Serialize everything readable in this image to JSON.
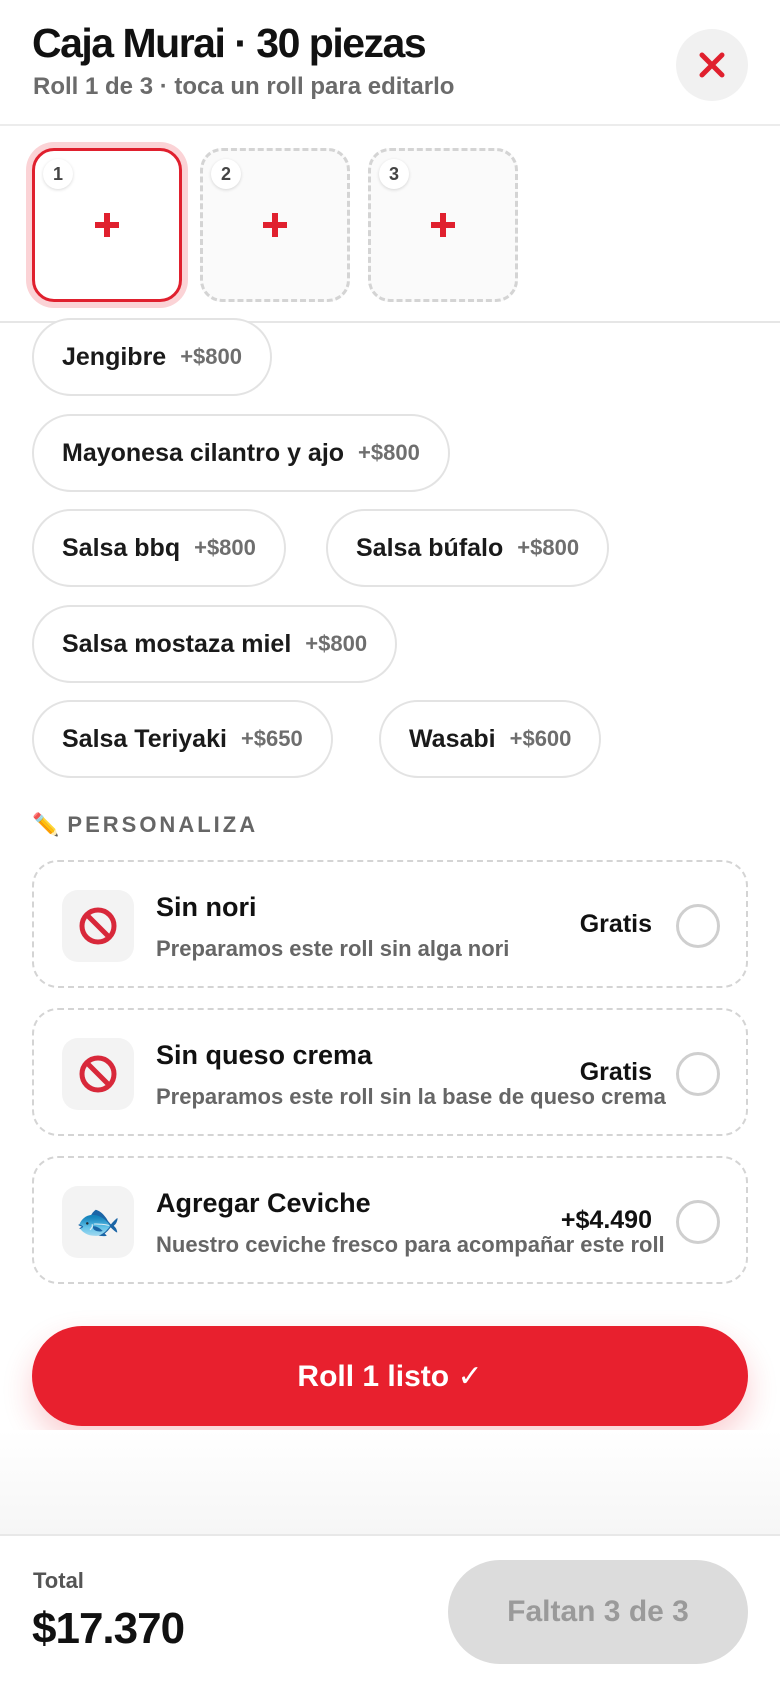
{
  "header": {
    "title": "Caja Murai · 30 piezas",
    "subtitle": "Roll 1 de 3 · toca un roll para editarlo",
    "close_icon": "close-x-icon"
  },
  "slots": [
    {
      "number": "1",
      "active": true,
      "icon": "plus-icon"
    },
    {
      "number": "2",
      "active": false,
      "icon": "plus-icon"
    },
    {
      "number": "3",
      "active": false,
      "icon": "plus-icon"
    }
  ],
  "sauces": [
    {
      "name": "Jengibre",
      "price": "+$800"
    },
    {
      "name": "Mayonesa cilantro y ajo",
      "price": "+$800"
    },
    {
      "name": "Salsa bbq",
      "price": "+$800"
    },
    {
      "name": "Salsa búfalo",
      "price": "+$800"
    },
    {
      "name": "Salsa mostaza miel",
      "price": "+$800"
    },
    {
      "name": "Salsa Teriyaki",
      "price": "+$650"
    },
    {
      "name": "Wasabi",
      "price": "+$600"
    }
  ],
  "personaliza": {
    "label": "PERSONALIZA",
    "icon": "pencil-icon",
    "pencil_glyph": "✏️",
    "options": [
      {
        "title": "Sin nori",
        "description": "Preparamos este roll sin alga nori",
        "price": "Gratis",
        "icon": "prohibited-icon",
        "selected": false
      },
      {
        "title": "Sin queso crema",
        "description": "Preparamos este roll sin la base de queso crema",
        "price": "Gratis",
        "icon": "prohibited-icon",
        "selected": false
      },
      {
        "title": "Agregar Ceviche",
        "description": "Nuestro ceviche fresco para acompañar este roll",
        "price": "+$4.490",
        "icon": "fish-icon",
        "icon_glyph": "🐟",
        "selected": false
      }
    ]
  },
  "cta": {
    "label": "Roll 1 listo ✓"
  },
  "footer": {
    "total_label": "Total",
    "total_value": "$17.370",
    "missing_label": "Faltan 3 de 3"
  },
  "colors": {
    "accent": "#e8202e",
    "accent_ring": "#fbd3d6",
    "muted_text": "#6b6b6b",
    "disabled_bg": "#dcdcdc"
  }
}
